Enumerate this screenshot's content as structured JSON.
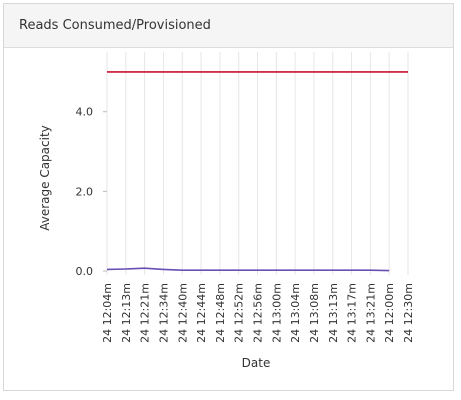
{
  "panel": {
    "title": "Reads Consumed/Provisioned"
  },
  "chart_data": {
    "type": "line",
    "title": "",
    "xlabel": "Date",
    "ylabel": "Average Capacity",
    "categories": [
      "24 12:04m",
      "24 12:13m",
      "24 12:21m",
      "24 12:34m",
      "24 12:40m",
      "24 12:44m",
      "24 12:48m",
      "24 12:52m",
      "24 12:56m",
      "24 13:00m",
      "24 13:04m",
      "24 13:08m",
      "24 13:13m",
      "24 13:17m",
      "24 13:21m",
      "24 12:00m",
      "24 12:30m"
    ],
    "yticks": [
      "0.0",
      "2.0",
      "4.0"
    ],
    "ylim": [
      0,
      5.5
    ],
    "grid": true,
    "series": [
      {
        "color": "#c8102e",
        "values": [
          5,
          5,
          5,
          5,
          5,
          5,
          5,
          5,
          5,
          5,
          5,
          5,
          5,
          5,
          5,
          5,
          5
        ]
      },
      {
        "color": "#6a4fb3",
        "values": [
          0.04,
          0.05,
          0.07,
          0.04,
          0.02,
          0.02,
          0.02,
          0.02,
          0.02,
          0.02,
          0.02,
          0.02,
          0.02,
          0.02,
          0.02,
          0.01,
          null
        ]
      }
    ]
  }
}
